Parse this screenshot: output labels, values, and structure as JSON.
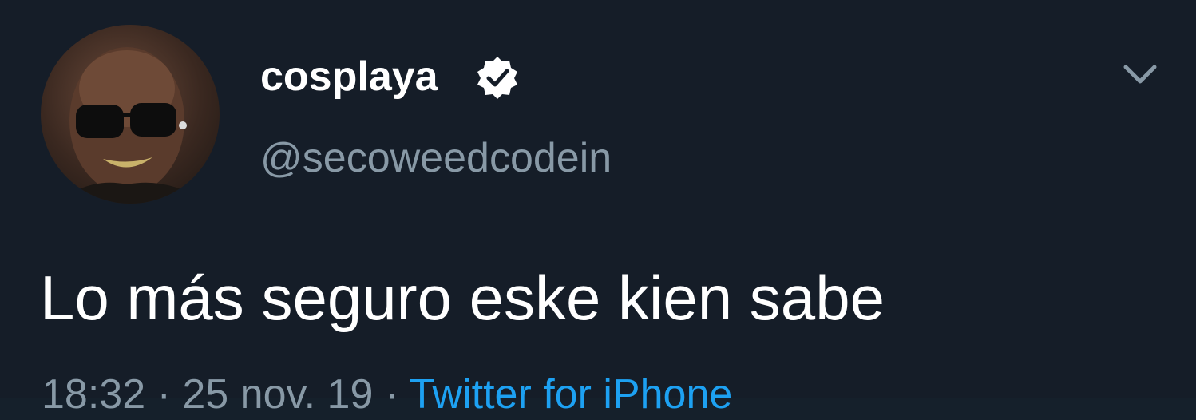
{
  "user": {
    "display_name": "cosplaya",
    "handle": "@secoweedcodein",
    "verified": true,
    "avatar_alt": "Profile photo"
  },
  "tweet": {
    "text": "Lo más seguro eske kien sabe",
    "time": "18:32",
    "separator1": " · ",
    "date": "25 nov. 19",
    "separator2": " · ",
    "source": "Twitter for iPhone"
  },
  "icons": {
    "verified": "verified-badge-icon",
    "menu": "chevron-down-icon"
  },
  "colors": {
    "background": "#151d28",
    "primary_text": "#ffffff",
    "secondary_text": "#8899a6",
    "link": "#1da1f2"
  }
}
